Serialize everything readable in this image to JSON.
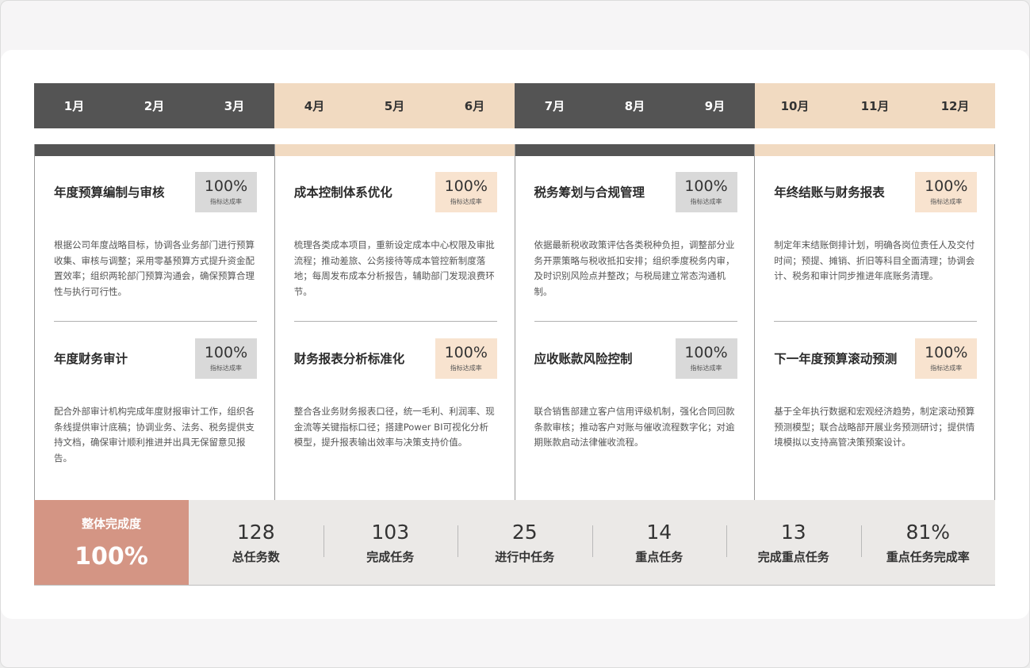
{
  "months": [
    "1月",
    "2月",
    "3月",
    "4月",
    "5月",
    "6月",
    "7月",
    "8月",
    "9月",
    "10月",
    "11月",
    "12月"
  ],
  "badge_label": "指标达成率",
  "columns": [
    {
      "tasks": [
        {
          "title": "年度预算编制与审核",
          "rate": "100%",
          "desc": "根据公司年度战略目标，协调各业务部门进行预算收集、审核与调整；采用零基预算方式提升资金配置效率；组织两轮部门预算沟通会，确保预算合理性与执行可行性。"
        },
        {
          "title": "年度财务审计",
          "rate": "100%",
          "desc": "配合外部审计机构完成年度财报审计工作，组织各条线提供审计底稿；协调业务、法务、税务提供支持文档，确保审计顺利推进并出具无保留意见报告。"
        }
      ]
    },
    {
      "tasks": [
        {
          "title": "成本控制体系优化",
          "rate": "100%",
          "desc": "梳理各类成本项目，重新设定成本中心权限及审批流程；推动差旅、公务接待等成本管控新制度落地；每周发布成本分析报告，辅助部门发现浪费环节。"
        },
        {
          "title": "财务报表分析标准化",
          "rate": "100%",
          "desc": "整合各业务财务报表口径，统一毛利、利润率、现金流等关键指标口径；搭建Power BI可视化分析模型，提升报表输出效率与决策支持价值。"
        }
      ]
    },
    {
      "tasks": [
        {
          "title": "税务筹划与合规管理",
          "rate": "100%",
          "desc": "依据最新税收政策评估各类税种负担，调整部分业务开票策略与税收抵扣安排；组织季度税务内审，及时识别风险点并整改；与税局建立常态沟通机制。"
        },
        {
          "title": "应收账款风险控制",
          "rate": "100%",
          "desc": "联合销售部建立客户信用评级机制，强化合同回款条款审核；推动客户对账与催收流程数字化；对逾期账款启动法律催收流程。"
        }
      ]
    },
    {
      "tasks": [
        {
          "title": "年终结账与财务报表",
          "rate": "100%",
          "desc": "制定年末结账倒排计划，明确各岗位责任人及交付时间；预提、摊销、折旧等科目全面清理；协调会计、税务和审计同步推进年底账务清理。"
        },
        {
          "title": "下一年度预算滚动预测",
          "rate": "100%",
          "desc": "基于全年执行数据和宏观经济趋势，制定滚动预算预测模型；联合战略部开展业务预测研讨；提供情境模拟以支持高管决策预案设计。"
        }
      ]
    }
  ],
  "overall": {
    "label": "整体完成度",
    "value": "100%"
  },
  "stats": [
    {
      "value": "128",
      "label": "总任务数"
    },
    {
      "value": "103",
      "label": "完成任务"
    },
    {
      "value": "25",
      "label": "进行中任务"
    },
    {
      "value": "14",
      "label": "重点任务"
    },
    {
      "value": "13",
      "label": "完成重点任务"
    },
    {
      "value": "81%",
      "label": "重点任务完成率"
    }
  ]
}
